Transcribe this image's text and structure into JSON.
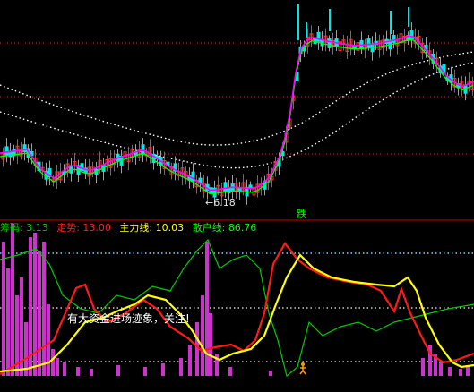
{
  "legend": {
    "chip_label": "筹码",
    "chip_value": "3.13",
    "trend_label": "走势",
    "trend_value": "13.00",
    "main_label": "主力线",
    "main_value": "10.03",
    "retail_label": "散户线",
    "retail_value": "86.76"
  },
  "annotations": {
    "low_price": "←6.18",
    "signal": "跌",
    "note": "有大资金进场迹象，关注!"
  },
  "colors": {
    "background": "#000000",
    "up": "#ff3030",
    "down": "#00e5e5",
    "ma_short": "#ff00ff",
    "ma_mid": "#00ff00",
    "ma_long": "#ffffff",
    "trend": "#ff1a1a",
    "main": "#ffff00",
    "retail": "#00cc00",
    "volume_bar": "#cc33cc",
    "separator": "#cc0000"
  },
  "icons": {
    "bottom_marker": "person-icon"
  }
}
